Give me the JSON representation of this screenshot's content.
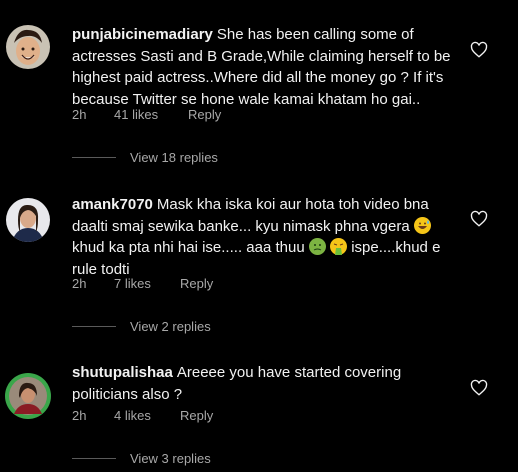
{
  "comments": [
    {
      "username": "punjabicinemadiary",
      "text": "She has been calling some of actresses Sasti and B Grade,While claiming herself to be highest paid actress..Where did all the money go ? If it's because Twitter se hone wale kamai khatam ho gai..",
      "time": "2h",
      "likes": "41 likes",
      "reply": "Reply",
      "view_replies": "View 18 replies",
      "avatar_icon": "avatar-man-smiling"
    },
    {
      "username": "amank7070",
      "text_part1": "Mask kha iska koi aur hota toh video bna daalti smaj sewika banke... kyu nimask phna vgera",
      "text_part2": "khud ka pta nhi hai ise..... aaa thuu",
      "text_part3": "ispe....khud e rule todti",
      "emojis": [
        "grinning-sweat-emoji",
        "nauseated-face-emoji",
        "vomiting-face-emoji"
      ],
      "time": "2h",
      "likes": "7 likes",
      "reply": "Reply",
      "view_replies": "View 2 replies",
      "avatar_icon": "avatar-woman"
    },
    {
      "username": "shutupalishaa",
      "text": "Areeee you have started covering politicians also ?",
      "time": "2h",
      "likes": "4 likes",
      "reply": "Reply",
      "view_replies": "View 3 replies",
      "avatar_icon": "avatar-woman-ring"
    }
  ],
  "colors": {
    "background": "#000000",
    "text": "#f2f2f2",
    "meta": "#a8a8a8",
    "avatar_ring": "#3aa64a"
  }
}
